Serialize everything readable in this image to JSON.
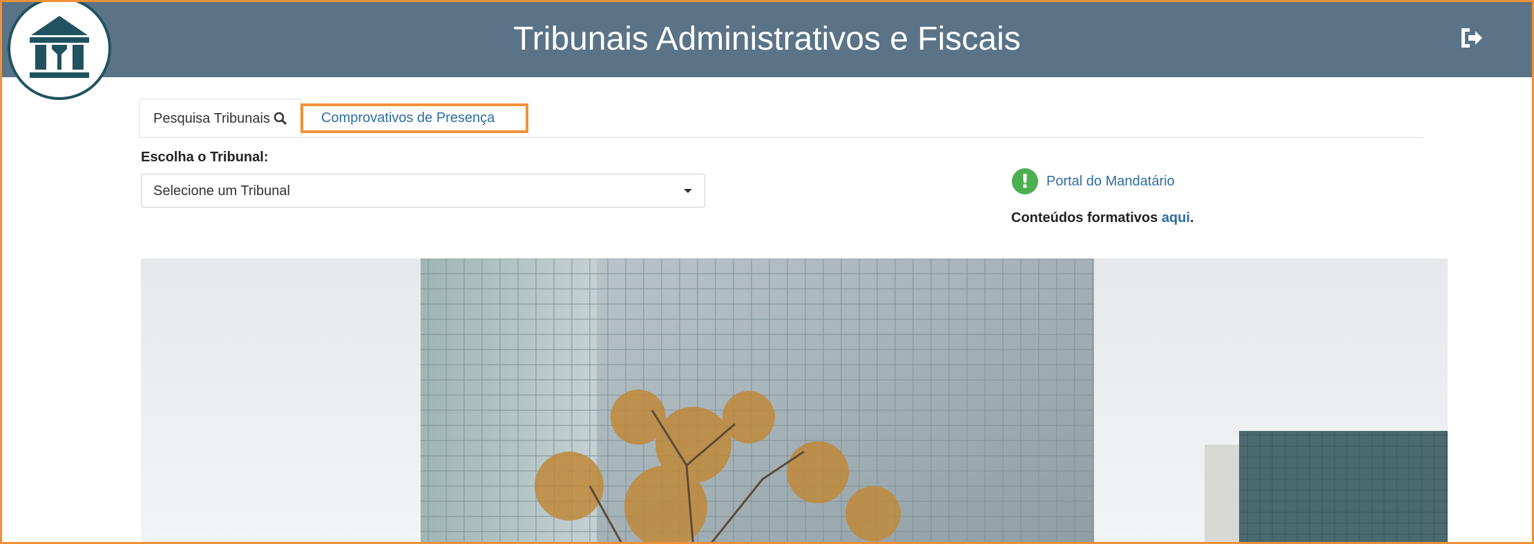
{
  "header": {
    "title": "Tribunais Administrativos e Fiscais",
    "logout_icon": "sign-out-icon",
    "logo_icon": "courthouse-logo"
  },
  "tabs": [
    {
      "label": "Pesquisa Tribunais",
      "icon": "search-icon",
      "active": true
    },
    {
      "label": "Comprovativos de Presença",
      "active": false
    }
  ],
  "form": {
    "tribunal_label": "Escolha o Tribunal:",
    "tribunal_select_value": "Selecione um Tribunal"
  },
  "sidebar": {
    "portal_icon_glyph": "!",
    "portal_link": "Portal do Mandatário",
    "formativos_text": "Conteúdos formativos",
    "formativos_link": "aqui",
    "formativos_end": "."
  },
  "colors": {
    "header_bg": "#5b7386",
    "frame_border": "#f0913a",
    "link": "#2e6da4",
    "portal_icon": "#4caf50",
    "logo": "#21525f"
  }
}
